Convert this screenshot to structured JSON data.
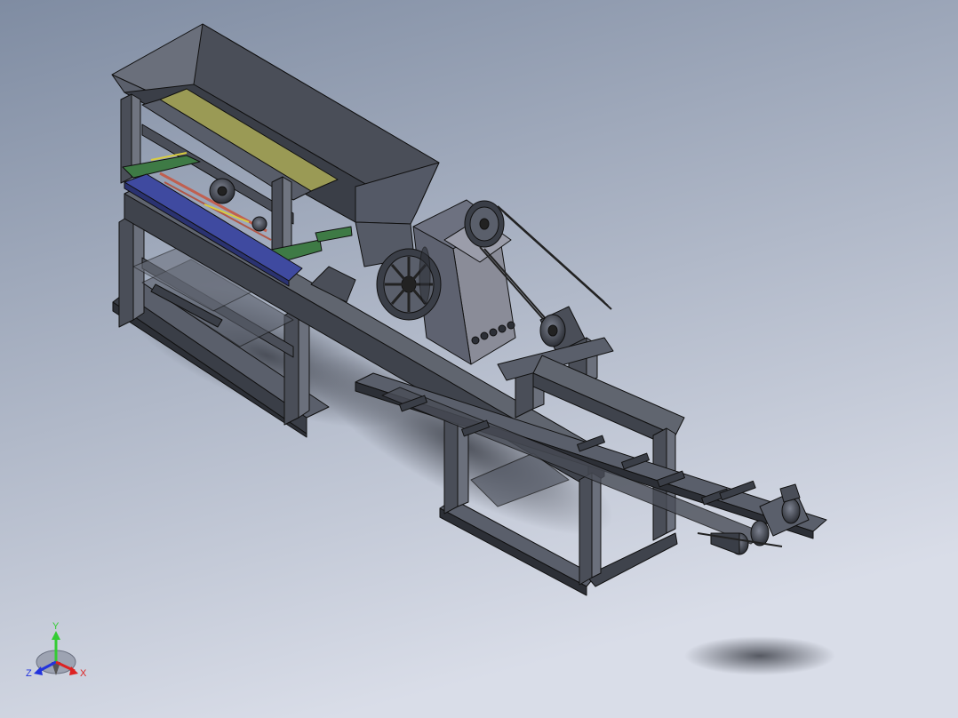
{
  "viewport": {
    "background_top": "#7f8ca2",
    "background_bottom": "#d9dde8"
  },
  "model": {
    "colors": {
      "steel": "#4a4e58",
      "steel_light": "#6b707c",
      "steel_dark": "#2c2f36",
      "screen_deck": "#9a9a55",
      "frame_green": "#3e7a45",
      "frame_blue": "#3f4aa0",
      "crusher_body": "#8a8c98",
      "edge": "#111111"
    }
  },
  "triad": {
    "y_label": "Y",
    "z_label": "Z",
    "x_label": "X",
    "y_color": "#33cc33",
    "z_color": "#2233dd",
    "x_color": "#dd2222"
  }
}
